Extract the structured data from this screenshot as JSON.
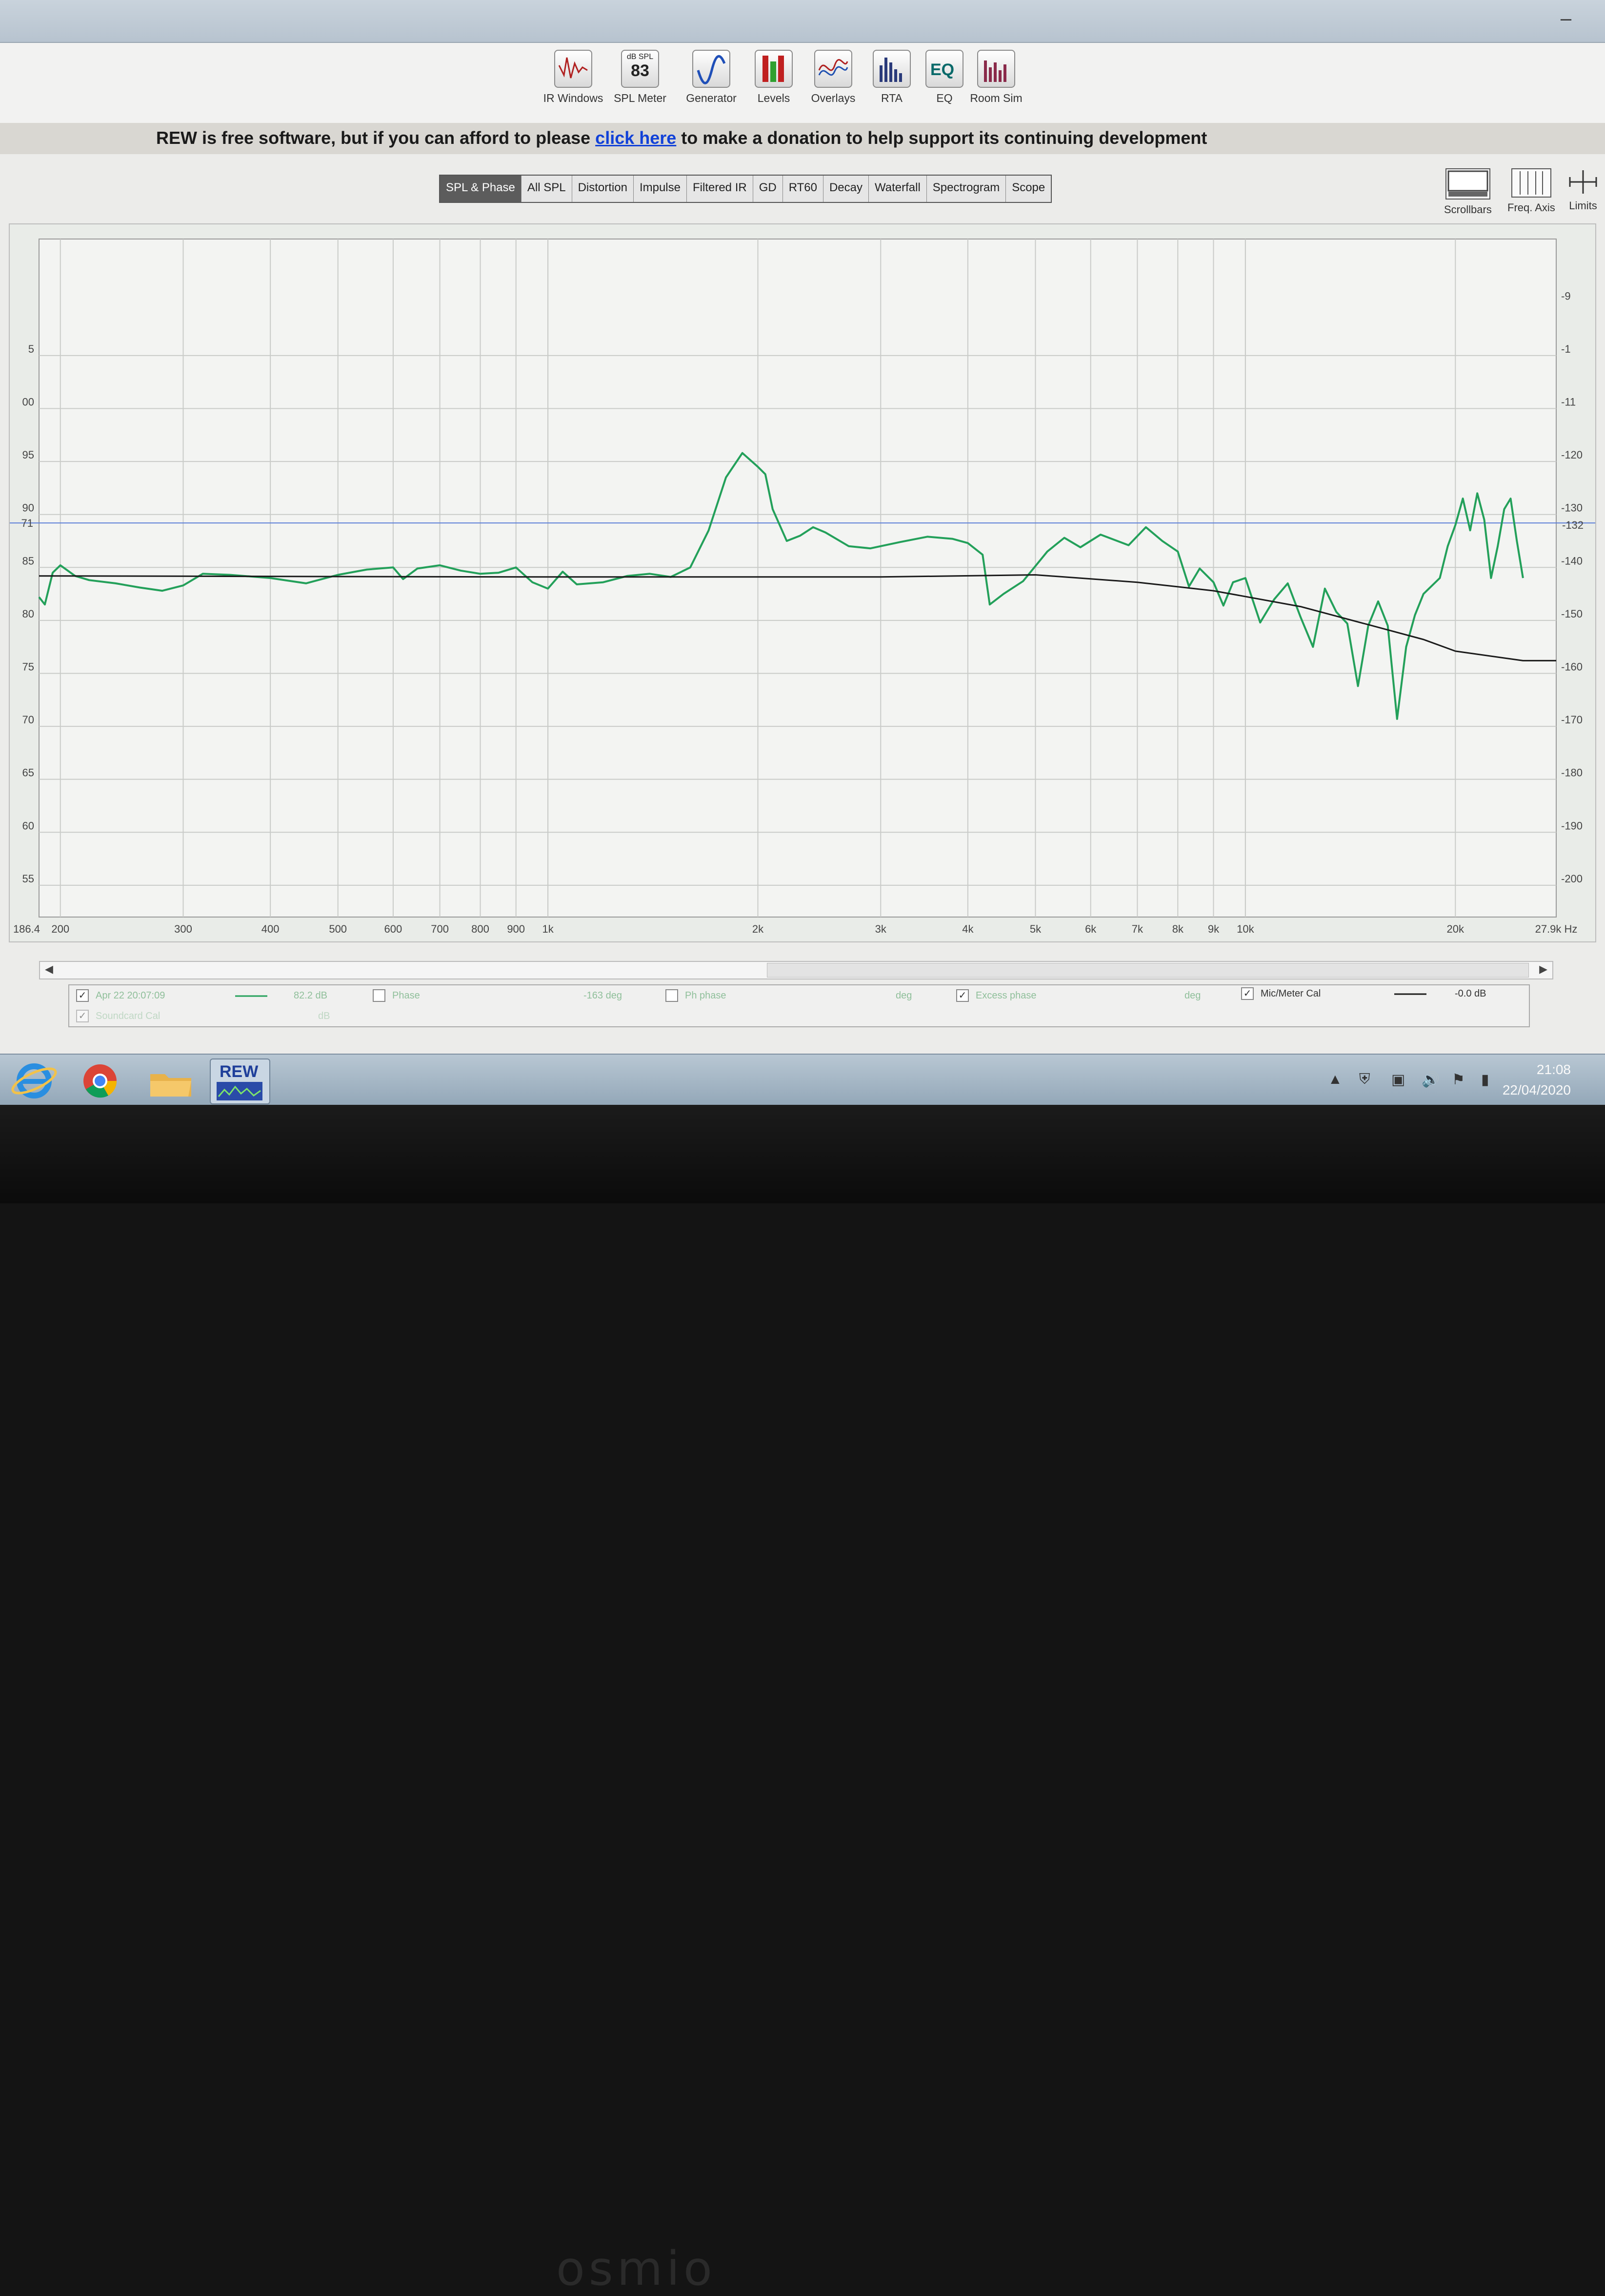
{
  "toolbar": {
    "items": [
      {
        "label": "IR Windows",
        "icon": "ir-windows-icon"
      },
      {
        "label": "SPL Meter",
        "icon": "spl-meter-icon",
        "badge_top": "dB SPL",
        "badge_value": "83"
      },
      {
        "label": "Generator",
        "icon": "generator-icon"
      },
      {
        "label": "Levels",
        "icon": "levels-icon"
      },
      {
        "label": "Overlays",
        "icon": "overlays-icon"
      },
      {
        "label": "RTA",
        "icon": "rta-icon"
      },
      {
        "label": "EQ",
        "icon": "eq-icon"
      },
      {
        "label": "Room Sim",
        "icon": "room-sim-icon"
      }
    ]
  },
  "banner": {
    "pre": "REW is free software, but if you can afford to please ",
    "link": "click here",
    "post": " to make a donation to help support its continuing development"
  },
  "tabs": [
    "SPL & Phase",
    "All SPL",
    "Distortion",
    "Impulse",
    "Filtered IR",
    "GD",
    "RT60",
    "Decay",
    "Waterfall",
    "Spectrogram",
    "Scope"
  ],
  "active_tab": "SPL & Phase",
  "right_tools": [
    {
      "label": "Scrollbars",
      "icon": "scrollbars-icon"
    },
    {
      "label": "Freq. Axis",
      "icon": "freq-axis-icon"
    },
    {
      "label": "Limits",
      "icon": "limits-icon"
    }
  ],
  "chart_data": {
    "type": "line",
    "x_scale": "log",
    "xlim": [
      186.4,
      27900
    ],
    "x_start_label": "186.4",
    "x_ticks": [
      {
        "value": 200,
        "label": "200"
      },
      {
        "value": 300,
        "label": "300"
      },
      {
        "value": 400,
        "label": "400"
      },
      {
        "value": 500,
        "label": "500"
      },
      {
        "value": 600,
        "label": "600"
      },
      {
        "value": 700,
        "label": "700"
      },
      {
        "value": 800,
        "label": "800"
      },
      {
        "value": 900,
        "label": "900"
      },
      {
        "value": 1000,
        "label": "1k"
      },
      {
        "value": 2000,
        "label": "2k"
      },
      {
        "value": 3000,
        "label": "3k"
      },
      {
        "value": 4000,
        "label": "4k"
      },
      {
        "value": 5000,
        "label": "5k"
      },
      {
        "value": 6000,
        "label": "6k"
      },
      {
        "value": 7000,
        "label": "7k"
      },
      {
        "value": 8000,
        "label": "8k"
      },
      {
        "value": 9000,
        "label": "9k"
      },
      {
        "value": 10000,
        "label": "10k"
      },
      {
        "value": 20000,
        "label": "20k"
      },
      {
        "value": 27900,
        "label": "27.9k Hz"
      }
    ],
    "y_left_ticks": [
      55,
      60,
      65,
      70,
      75,
      80,
      85,
      90,
      95,
      100,
      105
    ],
    "y_left_labels": [
      "55",
      "60",
      "65",
      "70",
      "75",
      "80",
      "85",
      "90",
      "95",
      "00",
      "5"
    ],
    "y_left_cursor": "71",
    "ylim_left": [
      52,
      116
    ],
    "y_right_ticks": [
      -200,
      -190,
      -180,
      -170,
      -160,
      -150,
      -140,
      -130,
      -120,
      -110,
      -100,
      -90
    ],
    "y_right_labels": [
      "-200",
      "-190",
      "-180",
      "-170",
      "-160",
      "-150",
      "-140",
      "-130",
      "-120",
      "-11",
      "-1",
      "-9"
    ],
    "y_right_cursor": "-132",
    "cursor_level_db": 89.2,
    "grid": true,
    "series": [
      {
        "name": "Apr 22 20:07:09",
        "color": "#23a05a",
        "points": [
          [
            186.4,
            82.2
          ],
          [
            190,
            81.5
          ],
          [
            195,
            84.5
          ],
          [
            200,
            85.2
          ],
          [
            210,
            84.2
          ],
          [
            220,
            83.8
          ],
          [
            240,
            83.5
          ],
          [
            260,
            83.1
          ],
          [
            280,
            82.8
          ],
          [
            300,
            83.3
          ],
          [
            320,
            84.4
          ],
          [
            350,
            84.3
          ],
          [
            400,
            84.0
          ],
          [
            450,
            83.5
          ],
          [
            500,
            84.3
          ],
          [
            550,
            84.8
          ],
          [
            600,
            85.0
          ],
          [
            620,
            83.9
          ],
          [
            650,
            84.9
          ],
          [
            700,
            85.2
          ],
          [
            750,
            84.7
          ],
          [
            800,
            84.4
          ],
          [
            850,
            84.5
          ],
          [
            900,
            85.0
          ],
          [
            950,
            83.6
          ],
          [
            1000,
            83.0
          ],
          [
            1050,
            84.6
          ],
          [
            1100,
            83.4
          ],
          [
            1200,
            83.6
          ],
          [
            1300,
            84.2
          ],
          [
            1400,
            84.4
          ],
          [
            1500,
            84.1
          ],
          [
            1600,
            85.0
          ],
          [
            1700,
            88.5
          ],
          [
            1800,
            93.5
          ],
          [
            1900,
            95.8
          ],
          [
            2000,
            94.5
          ],
          [
            2050,
            93.8
          ],
          [
            2100,
            90.5
          ],
          [
            2200,
            87.5
          ],
          [
            2300,
            88.0
          ],
          [
            2400,
            88.8
          ],
          [
            2500,
            88.3
          ],
          [
            2700,
            87.0
          ],
          [
            2900,
            86.8
          ],
          [
            3200,
            87.4
          ],
          [
            3500,
            87.9
          ],
          [
            3800,
            87.7
          ],
          [
            4000,
            87.3
          ],
          [
            4200,
            86.2
          ],
          [
            4300,
            81.5
          ],
          [
            4500,
            82.5
          ],
          [
            4800,
            83.7
          ],
          [
            5200,
            86.5
          ],
          [
            5500,
            87.8
          ],
          [
            5800,
            86.9
          ],
          [
            6200,
            88.1
          ],
          [
            6800,
            87.1
          ],
          [
            7200,
            88.8
          ],
          [
            7600,
            87.5
          ],
          [
            8000,
            86.5
          ],
          [
            8300,
            83.2
          ],
          [
            8600,
            84.9
          ],
          [
            9000,
            83.6
          ],
          [
            9300,
            81.4
          ],
          [
            9600,
            83.6
          ],
          [
            10000,
            84.0
          ],
          [
            10500,
            79.8
          ],
          [
            11000,
            82.0
          ],
          [
            11500,
            83.5
          ],
          [
            12000,
            80.3
          ],
          [
            12500,
            77.5
          ],
          [
            13000,
            83.0
          ],
          [
            13500,
            80.8
          ],
          [
            14000,
            79.7
          ],
          [
            14500,
            73.8
          ],
          [
            15000,
            79.5
          ],
          [
            15500,
            81.8
          ],
          [
            16000,
            79.5
          ],
          [
            16500,
            70.7
          ],
          [
            17000,
            77.5
          ],
          [
            17500,
            80.5
          ],
          [
            18000,
            82.5
          ],
          [
            19000,
            84.0
          ],
          [
            19500,
            87.0
          ],
          [
            20000,
            89.0
          ],
          [
            20500,
            91.5
          ],
          [
            21000,
            88.5
          ],
          [
            21500,
            92.0
          ],
          [
            22000,
            89.5
          ],
          [
            22500,
            84.0
          ],
          [
            23000,
            87.0
          ],
          [
            23500,
            90.5
          ],
          [
            24000,
            91.5
          ],
          [
            24500,
            87.5
          ],
          [
            25000,
            84.0
          ]
        ]
      },
      {
        "name": "Mic/Meter Cal",
        "color": "#1a1a1a",
        "points": [
          [
            186.4,
            84.2
          ],
          [
            1000,
            84.1
          ],
          [
            3000,
            84.1
          ],
          [
            5000,
            84.3
          ],
          [
            7000,
            83.6
          ],
          [
            9000,
            82.8
          ],
          [
            12000,
            81.3
          ],
          [
            15000,
            79.6
          ],
          [
            18000,
            78.2
          ],
          [
            20000,
            77.1
          ],
          [
            25000,
            76.2
          ],
          [
            27900,
            76.2
          ]
        ]
      }
    ]
  },
  "legend": {
    "row1": [
      {
        "label": "Apr 22 20:07:09",
        "value": "82.2 dB",
        "checked": true
      },
      {
        "label": "Phase",
        "value": "-163 deg",
        "checked": false
      },
      {
        "label": "Ph phase",
        "value": "deg",
        "checked": false
      },
      {
        "label": "Excess phase",
        "value": "deg",
        "checked": true
      },
      {
        "label": "Mic/Meter Cal",
        "value": "-0.0 dB",
        "checked": true
      }
    ],
    "row2": [
      {
        "label": "Soundcard Cal",
        "value": "dB",
        "checked": true
      }
    ]
  },
  "taskbar": {
    "apps": [
      "internet-explorer-icon",
      "chrome-icon",
      "folder-icon",
      "rew-icon"
    ],
    "rew_label": "REW",
    "time": "21:08",
    "date": "22/04/2020"
  },
  "bezel": {
    "brand": "osmio"
  }
}
